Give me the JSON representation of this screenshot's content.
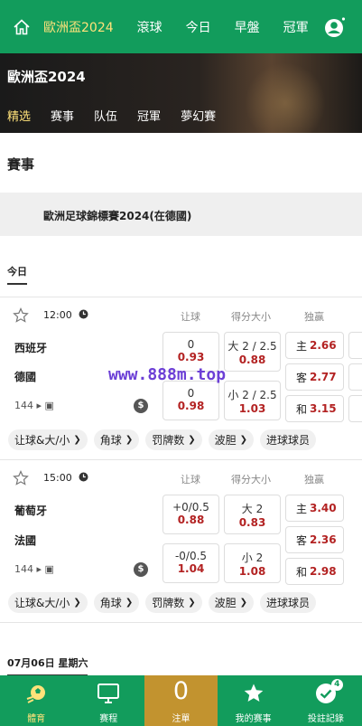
{
  "nav": {
    "items": [
      "歐洲盃2024",
      "滾球",
      "今日",
      "早盤",
      "冠軍"
    ]
  },
  "banner": {
    "title": "歐洲盃2024",
    "tabs": [
      "精选",
      "赛事",
      "队伍",
      "冠軍",
      "夢幻賽"
    ]
  },
  "section_title": "賽事",
  "league_name": "歐洲足球錦標賽2024(在德國)",
  "today_label": "今日",
  "columns": {
    "handicap": "让球",
    "overunder": "得分大小",
    "winner": "独赢"
  },
  "matches": [
    {
      "time": "12:00",
      "home": "西班牙",
      "away": "德國",
      "count": "144",
      "hdp": [
        {
          "line": "0",
          "odds": "0.93"
        },
        {
          "line": "0",
          "odds": "0.98"
        }
      ],
      "ou": [
        {
          "line": "大 2 / 2.5",
          "odds": "0.88"
        },
        {
          "line": "小 2 / 2.5",
          "odds": "1.03"
        }
      ],
      "win": [
        {
          "label": "主",
          "odds": "2.66"
        },
        {
          "label": "客",
          "odds": "2.77"
        },
        {
          "label": "和",
          "odds": "3.15"
        }
      ],
      "coin": "$",
      "chips": [
        "让球&大/小",
        "角球",
        "罚牌数",
        "波胆",
        "进球球员"
      ]
    },
    {
      "time": "15:00",
      "home": "葡萄牙",
      "away": "法國",
      "count": "144",
      "hdp": [
        {
          "line": "+0/0.5",
          "odds": "0.88"
        },
        {
          "line": "-0/0.5",
          "odds": "1.04"
        }
      ],
      "ou": [
        {
          "line": "大 2",
          "odds": "0.83"
        },
        {
          "line": "小 2",
          "odds": "1.08"
        }
      ],
      "win": [
        {
          "label": "主",
          "odds": "3.40"
        },
        {
          "label": "客",
          "odds": "2.36"
        },
        {
          "label": "和",
          "odds": "2.98"
        }
      ],
      "coin": "$",
      "chips": [
        "让球&大/小",
        "角球",
        "罚牌数",
        "波胆",
        "进球球员"
      ]
    }
  ],
  "next_date": "07月06日 星期六",
  "watermark": "www.888m.top",
  "bottom": {
    "sports": "體育",
    "schedule": "赛程",
    "slip_count": "0",
    "slip": "注單",
    "my_events": "我的赛事",
    "records": "投註記錄",
    "records_badge": "4"
  },
  "colors": {
    "primary": "#129c5c",
    "accent": "#ffe27a",
    "odds": "#b32222",
    "slip": "#c2932f"
  }
}
